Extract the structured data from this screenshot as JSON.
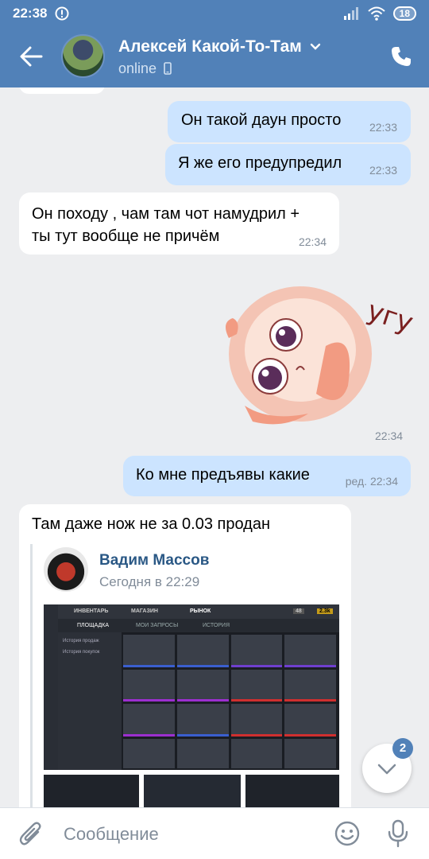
{
  "status_bar": {
    "time": "22:38",
    "battery": "18"
  },
  "header": {
    "contact_name": "Алексей Какой-То-Там",
    "contact_status": "online"
  },
  "messages": [
    {
      "text": "Он такой даун просто",
      "time": "22:33",
      "direction": "out"
    },
    {
      "text": "Я же его предупредил",
      "time": "22:33",
      "direction": "out"
    },
    {
      "text": "Он походу , чам там чот намудрил + ты тут вообще не причём",
      "time": "22:34",
      "direction": "in"
    },
    {
      "sticker_caption": "угу",
      "time": "22:34",
      "direction": "out"
    },
    {
      "text": "Ко мне предъявы какие",
      "time": "ред. 22:34",
      "direction": "out"
    },
    {
      "text": "Там даже нож не за 0.03 продан",
      "direction": "in"
    }
  ],
  "repost": {
    "author": "Вадим Массов",
    "date": "Сегодня в 22:29",
    "screenshot": {
      "tabs": [
        "ИНВЕНТАРЬ",
        "МАГАЗИН",
        "РЫНОК"
      ],
      "subtabs": [
        "ПЛОЩАДКА",
        "МОИ ЗАПРОСЫ",
        "ИСТОРИЯ"
      ],
      "side_items": [
        "История продаж",
        "История покупок"
      ],
      "balance_1": "48",
      "balance_2": "2.3k"
    }
  },
  "unread_count": "2",
  "composer": {
    "placeholder": "Сообщение"
  },
  "colors": {
    "header_bg": "#5181b8",
    "bubble_out": "#cce4ff",
    "bubble_in": "#ffffff",
    "chat_bg": "#edeef0"
  }
}
